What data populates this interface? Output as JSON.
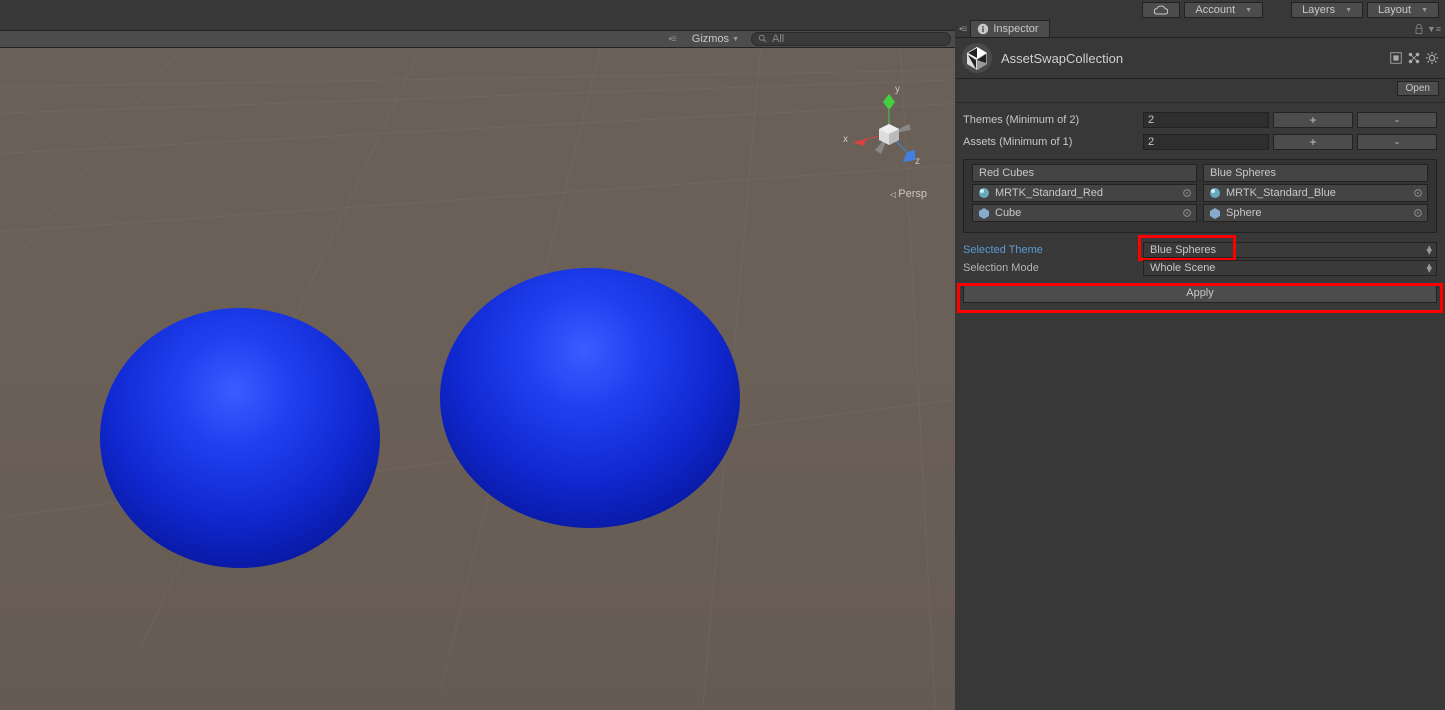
{
  "toolbar": {
    "account": "Account",
    "layers": "Layers",
    "layout": "Layout"
  },
  "scene": {
    "gizmos": "Gizmos",
    "search_placeholder": "All",
    "persp_label": "Persp",
    "axes": {
      "x": "x",
      "y": "y",
      "z": "z"
    }
  },
  "inspector": {
    "tab": "Inspector",
    "asset_title": "AssetSwapCollection",
    "open_btn": "Open",
    "themes_label": "Themes (Minimum of 2)",
    "themes_value": "2",
    "assets_label": "Assets (Minimum of 1)",
    "assets_value": "2",
    "plus": "+",
    "minus": "-",
    "columns": [
      {
        "name": "Red Cubes",
        "items": [
          {
            "icon": "material",
            "label": "MRTK_Standard_Red"
          },
          {
            "icon": "prefab",
            "label": "Cube"
          }
        ]
      },
      {
        "name": "Blue Spheres",
        "items": [
          {
            "icon": "material",
            "label": "MRTK_Standard_Blue"
          },
          {
            "icon": "prefab",
            "label": "Sphere"
          }
        ]
      }
    ],
    "selected_theme_label": "Selected Theme",
    "selected_theme_value": "Blue Spheres",
    "selection_mode_label": "Selection Mode",
    "selection_mode_value": "Whole Scene",
    "apply": "Apply"
  }
}
